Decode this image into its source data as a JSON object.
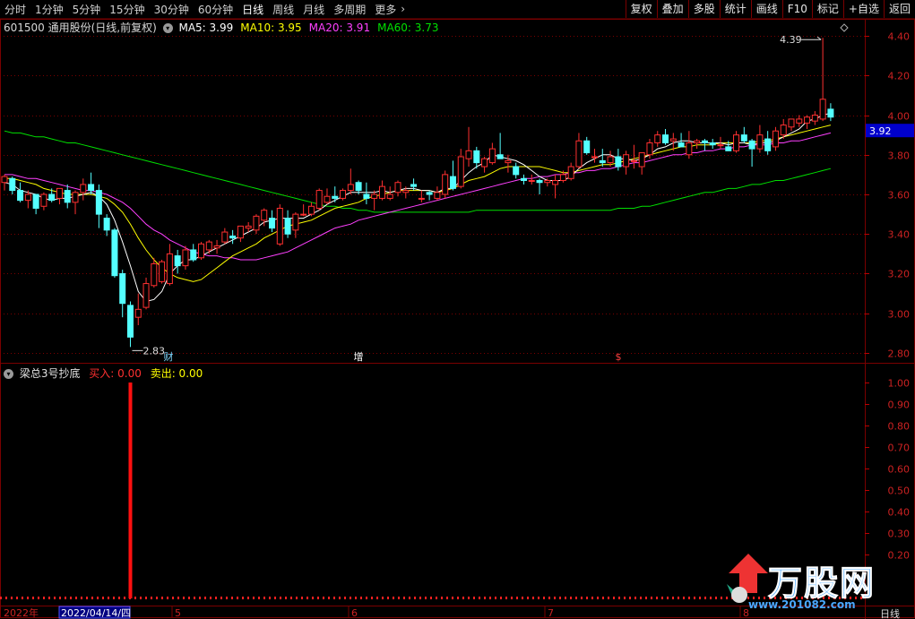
{
  "toolbar": {
    "periods": [
      "分时",
      "1分钟",
      "5分钟",
      "15分钟",
      "30分钟",
      "60分钟",
      "日线",
      "周线",
      "月线",
      "多周期",
      "更多"
    ],
    "active_period": "日线",
    "more_arrow": "›",
    "actions": [
      "复权",
      "叠加",
      "多股",
      "统计",
      "画线",
      "F10",
      "标记",
      "+自选",
      "返回"
    ]
  },
  "chart_header": {
    "title": "601500 通用股份(日线,前复权)",
    "ma": [
      {
        "label": "MA5: 3.99",
        "color": "#ffffff"
      },
      {
        "label": "MA10: 3.95",
        "color": "#ffff00"
      },
      {
        "label": "MA20: 3.91",
        "color": "#ff40ff"
      },
      {
        "label": "MA60: 3.73",
        "color": "#00e000"
      }
    ]
  },
  "indicator_header": {
    "title": "梁总3号抄底",
    "buy_label": "买入: 0.00",
    "sell_label": "卖出: 0.00"
  },
  "price_axis": {
    "ticks": [
      "4.40",
      "4.20",
      "4.00",
      "3.80",
      "3.60",
      "3.40",
      "3.20",
      "3.00",
      "2.80"
    ],
    "current": "3.92"
  },
  "indicator_axis": {
    "ticks": [
      "1.00",
      "0.90",
      "0.80",
      "0.70",
      "0.60",
      "0.50",
      "0.40",
      "0.30",
      "0.20"
    ]
  },
  "annotations": {
    "high_label": "4.39",
    "low_label": "2.83",
    "events": [
      "财",
      "增",
      "$"
    ]
  },
  "date_axis": {
    "year": "2022年",
    "cursor_date": "2022/04/14/四",
    "months": [
      "5",
      "6",
      "7",
      "8"
    ],
    "period": "日线"
  },
  "watermark": {
    "brand": "万股网",
    "url": "www.201082.com"
  },
  "colors": {
    "up": "#ff3030",
    "down": "#54ffff",
    "ma5": "#ffffff",
    "ma10": "#ffff00",
    "ma20": "#ff40ff",
    "ma60": "#00e000",
    "grid": "#7a0000"
  },
  "chart_data": {
    "type": "candlestick",
    "fields": [
      "open",
      "high",
      "low",
      "close"
    ],
    "candles": [
      [
        3.66,
        3.7,
        3.62,
        3.69
      ],
      [
        3.68,
        3.69,
        3.6,
        3.62
      ],
      [
        3.62,
        3.66,
        3.56,
        3.57
      ],
      [
        3.57,
        3.62,
        3.53,
        3.6
      ],
      [
        3.6,
        3.6,
        3.5,
        3.53
      ],
      [
        3.54,
        3.61,
        3.52,
        3.6
      ],
      [
        3.6,
        3.63,
        3.56,
        3.57
      ],
      [
        3.58,
        3.63,
        3.55,
        3.63
      ],
      [
        3.62,
        3.65,
        3.53,
        3.56
      ],
      [
        3.56,
        3.62,
        3.5,
        3.61
      ],
      [
        3.61,
        3.68,
        3.57,
        3.65
      ],
      [
        3.65,
        3.71,
        3.6,
        3.62
      ],
      [
        3.62,
        3.65,
        3.43,
        3.5
      ],
      [
        3.48,
        3.5,
        3.39,
        3.42
      ],
      [
        3.42,
        3.43,
        3.18,
        3.19
      ],
      [
        3.2,
        3.22,
        2.98,
        3.05
      ],
      [
        3.04,
        3.06,
        2.83,
        2.88
      ],
      [
        2.98,
        3.1,
        2.94,
        3.02
      ],
      [
        3.03,
        3.18,
        3.02,
        3.15
      ],
      [
        3.14,
        3.28,
        3.13,
        3.25
      ],
      [
        3.16,
        3.27,
        3.15,
        3.26
      ],
      [
        3.15,
        3.35,
        3.14,
        3.3
      ],
      [
        3.29,
        3.32,
        3.2,
        3.24
      ],
      [
        3.24,
        3.34,
        3.22,
        3.32
      ],
      [
        3.32,
        3.35,
        3.26,
        3.27
      ],
      [
        3.28,
        3.36,
        3.27,
        3.35
      ],
      [
        3.32,
        3.37,
        3.3,
        3.36
      ],
      [
        3.33,
        3.37,
        3.3,
        3.34
      ],
      [
        3.36,
        3.43,
        3.35,
        3.41
      ],
      [
        3.39,
        3.42,
        3.35,
        3.38
      ],
      [
        3.38,
        3.44,
        3.36,
        3.44
      ],
      [
        3.43,
        3.46,
        3.41,
        3.44
      ],
      [
        3.42,
        3.5,
        3.4,
        3.49
      ],
      [
        3.47,
        3.53,
        3.44,
        3.52
      ],
      [
        3.48,
        3.52,
        3.41,
        3.43
      ],
      [
        3.35,
        3.55,
        3.34,
        3.53
      ],
      [
        3.48,
        3.52,
        3.38,
        3.4
      ],
      [
        3.42,
        3.51,
        3.38,
        3.5
      ],
      [
        3.5,
        3.55,
        3.49,
        3.5
      ],
      [
        3.5,
        3.56,
        3.49,
        3.54
      ],
      [
        3.53,
        3.63,
        3.52,
        3.62
      ],
      [
        3.56,
        3.63,
        3.55,
        3.59
      ],
      [
        3.59,
        3.64,
        3.56,
        3.58
      ],
      [
        3.58,
        3.63,
        3.57,
        3.62
      ],
      [
        3.62,
        3.73,
        3.6,
        3.65
      ],
      [
        3.66,
        3.67,
        3.6,
        3.62
      ],
      [
        3.6,
        3.66,
        3.55,
        3.58
      ],
      [
        3.58,
        3.62,
        3.52,
        3.6
      ],
      [
        3.58,
        3.67,
        3.57,
        3.64
      ],
      [
        3.58,
        3.64,
        3.57,
        3.6
      ],
      [
        3.61,
        3.67,
        3.59,
        3.66
      ],
      [
        3.61,
        3.64,
        3.58,
        3.62
      ],
      [
        3.65,
        3.68,
        3.62,
        3.64
      ],
      [
        3.58,
        3.62,
        3.56,
        3.58
      ],
      [
        3.61,
        3.62,
        3.57,
        3.6
      ],
      [
        3.58,
        3.64,
        3.57,
        3.61
      ],
      [
        3.6,
        3.72,
        3.58,
        3.7
      ],
      [
        3.69,
        3.77,
        3.62,
        3.63
      ],
      [
        3.64,
        3.83,
        3.63,
        3.79
      ],
      [
        3.78,
        3.94,
        3.74,
        3.82
      ],
      [
        3.82,
        3.84,
        3.73,
        3.76
      ],
      [
        3.74,
        3.79,
        3.71,
        3.78
      ],
      [
        3.76,
        3.86,
        3.75,
        3.83
      ],
      [
        3.8,
        3.91,
        3.79,
        3.78
      ],
      [
        3.76,
        3.8,
        3.71,
        3.77
      ],
      [
        3.74,
        3.76,
        3.68,
        3.7
      ],
      [
        3.68,
        3.7,
        3.65,
        3.67
      ],
      [
        3.67,
        3.7,
        3.65,
        3.67
      ],
      [
        3.67,
        3.68,
        3.6,
        3.66
      ],
      [
        3.66,
        3.68,
        3.64,
        3.67
      ],
      [
        3.65,
        3.7,
        3.58,
        3.67
      ],
      [
        3.67,
        3.72,
        3.66,
        3.7
      ],
      [
        3.68,
        3.76,
        3.67,
        3.74
      ],
      [
        3.74,
        3.91,
        3.73,
        3.87
      ],
      [
        3.87,
        3.89,
        3.8,
        3.81
      ],
      [
        3.79,
        3.83,
        3.76,
        3.79
      ],
      [
        3.77,
        3.83,
        3.74,
        3.76
      ],
      [
        3.76,
        3.82,
        3.74,
        3.79
      ],
      [
        3.79,
        3.83,
        3.72,
        3.74
      ],
      [
        3.74,
        3.82,
        3.7,
        3.8
      ],
      [
        3.77,
        3.85,
        3.73,
        3.77
      ],
      [
        3.74,
        3.81,
        3.7,
        3.81
      ],
      [
        3.8,
        3.88,
        3.78,
        3.86
      ],
      [
        3.86,
        3.92,
        3.84,
        3.9
      ],
      [
        3.9,
        3.93,
        3.85,
        3.86
      ],
      [
        3.87,
        3.91,
        3.82,
        3.88
      ],
      [
        3.86,
        3.91,
        3.84,
        3.84
      ],
      [
        3.8,
        3.92,
        3.78,
        3.86
      ],
      [
        3.86,
        3.88,
        3.83,
        3.87
      ],
      [
        3.87,
        3.88,
        3.82,
        3.86
      ],
      [
        3.86,
        3.88,
        3.83,
        3.85
      ],
      [
        3.85,
        3.89,
        3.83,
        3.85
      ],
      [
        3.84,
        3.87,
        3.82,
        3.82
      ],
      [
        3.82,
        3.92,
        3.81,
        3.9
      ],
      [
        3.9,
        3.94,
        3.86,
        3.87
      ],
      [
        3.87,
        3.88,
        3.74,
        3.83
      ],
      [
        3.83,
        3.95,
        3.81,
        3.9
      ],
      [
        3.88,
        3.92,
        3.8,
        3.82
      ],
      [
        3.84,
        3.94,
        3.82,
        3.92
      ],
      [
        3.9,
        3.98,
        3.88,
        3.95
      ],
      [
        3.94,
        3.98,
        3.92,
        3.98
      ],
      [
        3.96,
        4.0,
        3.94,
        3.98
      ],
      [
        3.96,
        4.0,
        3.93,
        3.99
      ],
      [
        3.97,
        4.02,
        3.95,
        4.0
      ],
      [
        3.98,
        4.39,
        3.97,
        4.08
      ],
      [
        4.03,
        4.06,
        3.97,
        3.99
      ]
    ],
    "ma5": [
      3.66,
      3.65,
      3.62,
      3.61,
      3.6,
      3.58,
      3.57,
      3.58,
      3.58,
      3.59,
      3.6,
      3.61,
      3.59,
      3.55,
      3.47,
      3.36,
      3.24,
      3.11,
      3.06,
      3.07,
      3.11,
      3.2,
      3.24,
      3.27,
      3.27,
      3.29,
      3.31,
      3.33,
      3.35,
      3.37,
      3.39,
      3.41,
      3.43,
      3.46,
      3.47,
      3.48,
      3.48,
      3.48,
      3.48,
      3.5,
      3.52,
      3.55,
      3.57,
      3.59,
      3.61,
      3.61,
      3.61,
      3.61,
      3.62,
      3.61,
      3.62,
      3.63,
      3.63,
      3.62,
      3.62,
      3.61,
      3.63,
      3.63,
      3.67,
      3.71,
      3.74,
      3.76,
      3.8,
      3.79,
      3.78,
      3.77,
      3.75,
      3.72,
      3.69,
      3.67,
      3.67,
      3.67,
      3.69,
      3.73,
      3.76,
      3.78,
      3.8,
      3.8,
      3.78,
      3.78,
      3.77,
      3.78,
      3.8,
      3.83,
      3.84,
      3.86,
      3.87,
      3.87,
      3.86,
      3.86,
      3.86,
      3.86,
      3.85,
      3.86,
      3.86,
      3.85,
      3.86,
      3.86,
      3.87,
      3.89,
      3.91,
      3.93,
      3.97,
      3.98,
      4.0,
      4.01
    ],
    "ma10": [
      3.68,
      3.68,
      3.67,
      3.66,
      3.65,
      3.63,
      3.62,
      3.61,
      3.6,
      3.6,
      3.6,
      3.6,
      3.59,
      3.58,
      3.55,
      3.51,
      3.45,
      3.38,
      3.32,
      3.27,
      3.23,
      3.2,
      3.18,
      3.17,
      3.16,
      3.17,
      3.2,
      3.23,
      3.26,
      3.29,
      3.31,
      3.33,
      3.35,
      3.38,
      3.4,
      3.42,
      3.44,
      3.45,
      3.46,
      3.47,
      3.49,
      3.51,
      3.53,
      3.54,
      3.55,
      3.56,
      3.58,
      3.59,
      3.6,
      3.61,
      3.62,
      3.62,
      3.62,
      3.62,
      3.62,
      3.61,
      3.62,
      3.63,
      3.65,
      3.67,
      3.68,
      3.69,
      3.71,
      3.73,
      3.74,
      3.74,
      3.74,
      3.74,
      3.74,
      3.73,
      3.72,
      3.71,
      3.71,
      3.72,
      3.73,
      3.74,
      3.75,
      3.75,
      3.76,
      3.77,
      3.78,
      3.79,
      3.8,
      3.81,
      3.82,
      3.83,
      3.84,
      3.84,
      3.85,
      3.85,
      3.85,
      3.86,
      3.86,
      3.86,
      3.86,
      3.86,
      3.87,
      3.87,
      3.88,
      3.89,
      3.9,
      3.91,
      3.92,
      3.93,
      3.94,
      3.95
    ],
    "ma20": [
      3.7,
      3.7,
      3.69,
      3.68,
      3.68,
      3.67,
      3.66,
      3.65,
      3.64,
      3.63,
      3.62,
      3.62,
      3.61,
      3.6,
      3.58,
      3.56,
      3.53,
      3.49,
      3.45,
      3.42,
      3.4,
      3.37,
      3.35,
      3.33,
      3.31,
      3.3,
      3.29,
      3.29,
      3.28,
      3.28,
      3.27,
      3.27,
      3.27,
      3.28,
      3.29,
      3.3,
      3.31,
      3.33,
      3.35,
      3.37,
      3.39,
      3.41,
      3.43,
      3.44,
      3.45,
      3.47,
      3.48,
      3.49,
      3.5,
      3.51,
      3.52,
      3.53,
      3.54,
      3.55,
      3.56,
      3.57,
      3.58,
      3.59,
      3.6,
      3.61,
      3.62,
      3.63,
      3.64,
      3.65,
      3.66,
      3.67,
      3.68,
      3.68,
      3.69,
      3.69,
      3.7,
      3.7,
      3.71,
      3.71,
      3.72,
      3.72,
      3.73,
      3.73,
      3.74,
      3.75,
      3.76,
      3.76,
      3.77,
      3.78,
      3.79,
      3.8,
      3.8,
      3.81,
      3.81,
      3.82,
      3.82,
      3.83,
      3.83,
      3.84,
      3.84,
      3.85,
      3.85,
      3.85,
      3.86,
      3.86,
      3.87,
      3.87,
      3.88,
      3.89,
      3.9,
      3.91
    ],
    "ma60": [
      3.92,
      3.91,
      3.91,
      3.9,
      3.89,
      3.89,
      3.88,
      3.87,
      3.86,
      3.86,
      3.85,
      3.84,
      3.83,
      3.82,
      3.81,
      3.8,
      3.79,
      3.78,
      3.77,
      3.76,
      3.75,
      3.74,
      3.73,
      3.72,
      3.71,
      3.7,
      3.69,
      3.68,
      3.67,
      3.66,
      3.65,
      3.64,
      3.63,
      3.62,
      3.61,
      3.6,
      3.59,
      3.58,
      3.57,
      3.56,
      3.55,
      3.54,
      3.54,
      3.53,
      3.53,
      3.52,
      3.52,
      3.51,
      3.51,
      3.51,
      3.51,
      3.51,
      3.51,
      3.51,
      3.51,
      3.51,
      3.51,
      3.51,
      3.51,
      3.51,
      3.52,
      3.52,
      3.52,
      3.52,
      3.52,
      3.52,
      3.52,
      3.52,
      3.52,
      3.52,
      3.52,
      3.52,
      3.52,
      3.52,
      3.52,
      3.52,
      3.52,
      3.52,
      3.53,
      3.53,
      3.53,
      3.54,
      3.54,
      3.55,
      3.56,
      3.57,
      3.58,
      3.59,
      3.6,
      3.61,
      3.61,
      3.62,
      3.63,
      3.63,
      3.64,
      3.65,
      3.65,
      3.66,
      3.67,
      3.67,
      3.68,
      3.69,
      3.7,
      3.71,
      3.72,
      3.73
    ],
    "indicator": {
      "series": "买入",
      "values": [
        0,
        0,
        0,
        0,
        0,
        0,
        0,
        0,
        0,
        0,
        0,
        0,
        0,
        0,
        0,
        0,
        1,
        0,
        0,
        0,
        0,
        0,
        0,
        0,
        0,
        0,
        0,
        0,
        0,
        0,
        0,
        0,
        0,
        0,
        0,
        0,
        0,
        0,
        0,
        0,
        0,
        0,
        0,
        0,
        0,
        0,
        0,
        0,
        0,
        0,
        0,
        0,
        0,
        0,
        0,
        0,
        0,
        0,
        0,
        0,
        0,
        0,
        0,
        0,
        0,
        0,
        0,
        0,
        0,
        0,
        0,
        0,
        0,
        0,
        0,
        0,
        0,
        0,
        0,
        0,
        0,
        0,
        0,
        0,
        0,
        0,
        0,
        0,
        0,
        0,
        0,
        0,
        0,
        0,
        0,
        0,
        0,
        0,
        0,
        0,
        0,
        0,
        0,
        0,
        0,
        0
      ]
    },
    "price_ylim": [
      2.75,
      4.45
    ],
    "indicator_ylim": [
      0,
      1.05
    ]
  }
}
